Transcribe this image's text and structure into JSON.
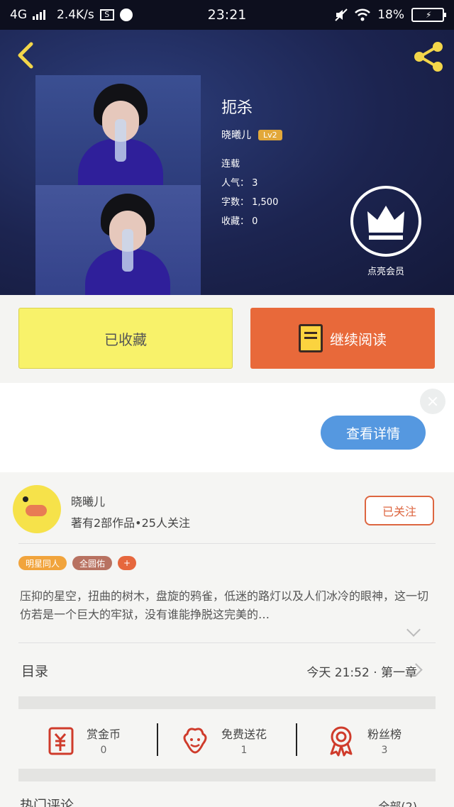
{
  "status_bar": {
    "network": "4G",
    "speed": "2.4K/s",
    "time": "23:21",
    "battery": "18%"
  },
  "book": {
    "title": "扼杀",
    "author": "晓曦儿",
    "level": "Lv2",
    "status": "连载",
    "popularity": "人气： 3",
    "word_count": "字数： 1,500",
    "collections": "收藏： 0"
  },
  "vip": {
    "label": "点亮会员"
  },
  "actions": {
    "collected_label": "已收藏",
    "continue_label": "继续阅读"
  },
  "ad": {
    "details_label": "查看详情"
  },
  "author_card": {
    "name": "晓曦儿",
    "stats": "著有2部作品•25人关注",
    "follow_label": "已关注"
  },
  "tags": [
    "明星同人",
    "全圆佑",
    "+"
  ],
  "summary": "压抑的星空，扭曲的树木，盘旋的鸦雀，低迷的路灯以及人们冰冷的眼神，这一切仿若是一个巨大的牢狱，没有谁能挣脱这完美的…",
  "toc": {
    "label": "目录",
    "latest": "今天 21:52 · 第一章"
  },
  "stats": [
    {
      "label": "赏金币",
      "value": "0",
      "icon": "reward-coin-icon"
    },
    {
      "label": "免费送花",
      "value": "1",
      "icon": "flower-icon"
    },
    {
      "label": "粉丝榜",
      "value": "3",
      "icon": "medal-icon"
    }
  ],
  "hot_comments": {
    "label": "热门评论",
    "all": "全部(2)"
  },
  "colors": {
    "accent": "#e8693a",
    "collect_yellow": "#f8f26a",
    "details_blue": "#5598e0",
    "level_badge": "#e2a83a"
  }
}
